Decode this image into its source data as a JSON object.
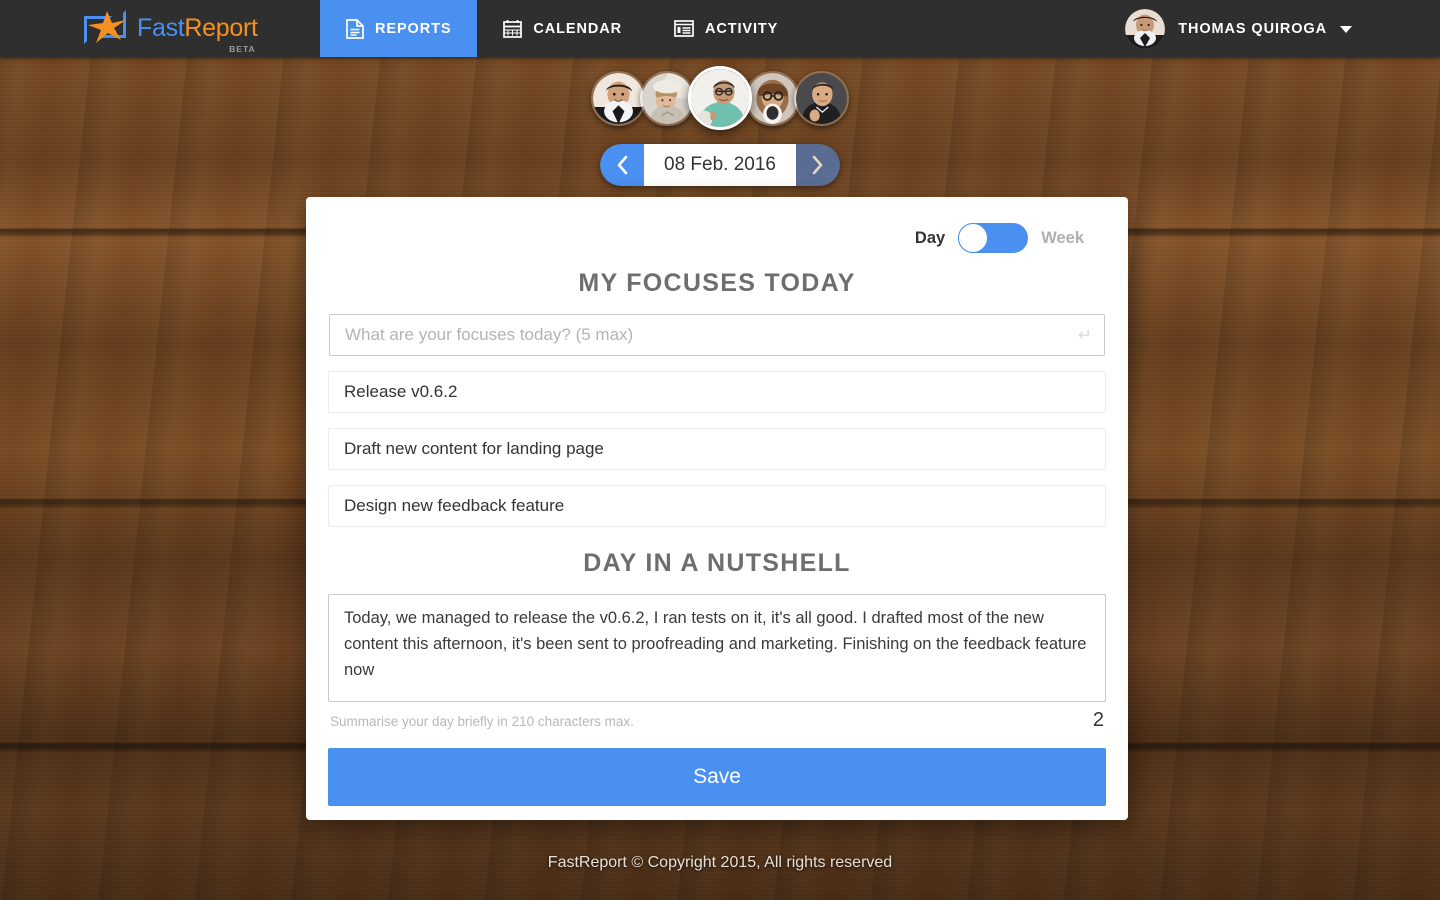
{
  "header": {
    "brand": {
      "name_first": "Fast",
      "name_second": "Report",
      "badge": "BETA",
      "logo_icon": "star-logo-icon"
    },
    "tabs": [
      {
        "label": "REPORTS",
        "icon": "document-icon",
        "active": true
      },
      {
        "label": "CALENDAR",
        "icon": "calendar-icon",
        "active": false
      },
      {
        "label": "ACTIVITY",
        "icon": "list-window-icon",
        "active": false
      }
    ],
    "user": {
      "name": "THOMAS QUIROGA",
      "avatar_icon": "user-avatar",
      "caret_icon": "chevron-down-icon"
    }
  },
  "team": {
    "avatars": [
      {
        "name": "team-avatar-1",
        "active": false
      },
      {
        "name": "team-avatar-2",
        "active": false
      },
      {
        "name": "team-avatar-3",
        "active": true
      },
      {
        "name": "team-avatar-4",
        "active": false
      },
      {
        "name": "team-avatar-5",
        "active": false
      }
    ]
  },
  "date_nav": {
    "prev_icon": "chevron-left-icon",
    "next_icon": "chevron-right-icon",
    "date": "08 Feb. 2016"
  },
  "card": {
    "view_toggle": {
      "left_label": "Day",
      "right_label": "Week",
      "selected": "Day"
    },
    "focuses": {
      "title": "MY FOCUSES TODAY",
      "input_value": "",
      "input_placeholder": "What are your focuses today? (5 max)",
      "enter_icon": "enter-return-icon",
      "items": [
        "Release v0.6.2",
        "Draft new content for landing page",
        "Design new feedback feature"
      ]
    },
    "nutshell": {
      "title": "DAY IN A NUTSHELL",
      "text": "Today, we managed to release the v0.6.2, I ran tests on it, it's all good. I drafted most of the new content this afternoon, it's been sent to proofreading and marketing. Finishing on the feedback feature now",
      "hint": "Summarise your day briefly in 210 characters max.",
      "char_count": "2"
    },
    "save_label": "Save"
  },
  "footer": {
    "text": "FastReport © Copyright 2015, All rights reserved"
  },
  "colors": {
    "accent_blue": "#4a90f0",
    "brand_orange": "#f59121",
    "header_bg": "#2f2f2f",
    "wood_brown": "#6b4524",
    "heading_gray": "#6e6e6e"
  }
}
